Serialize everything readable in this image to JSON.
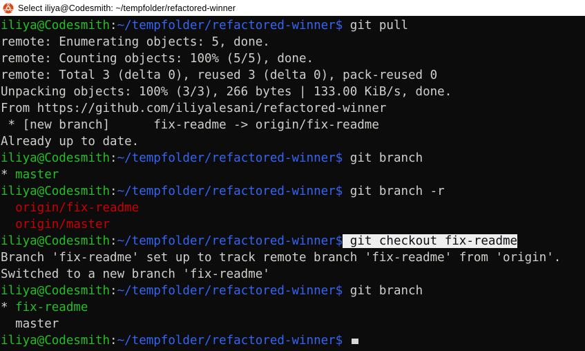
{
  "window": {
    "title": "Select iliya@Codesmith: ~/tempfolder/refactored-winner",
    "icon": "ubuntu-logo-icon",
    "titlebar_bg": "#ffffff",
    "titlebar_fg": "#000000"
  },
  "terminal": {
    "background": "#0c0c0c",
    "foreground": "#cccccc",
    "colors": {
      "green": "#26bd26",
      "blue": "#3465f4",
      "red": "#cc0000",
      "white": "#d0cfcc",
      "selection_bg": "#eeeeee",
      "selection_fg": "#0c0c12"
    },
    "prompt": {
      "user_host": "iliya@Codesmith",
      "separator": ":",
      "path": "~/tempfolder/refactored-winner",
      "sigil": "$"
    },
    "lines": [
      {
        "type": "prompt",
        "command": " git pull"
      },
      {
        "type": "output",
        "text": "remote: Enumerating objects: 5, done."
      },
      {
        "type": "output",
        "text": "remote: Counting objects: 100% (5/5), done."
      },
      {
        "type": "output",
        "text": "remote: Total 3 (delta 0), reused 3 (delta 0), pack-reused 0"
      },
      {
        "type": "output",
        "text": "Unpacking objects: 100% (3/3), 266 bytes | 133.00 KiB/s, done."
      },
      {
        "type": "output",
        "text": "From https://github.com/iliyalesani/refactored-winner"
      },
      {
        "type": "output",
        "text": " * [new branch]      fix-readme -> origin/fix-readme"
      },
      {
        "type": "output",
        "text": "Already up to date."
      },
      {
        "type": "prompt",
        "command": " git branch"
      },
      {
        "type": "branch_current",
        "marker": "* ",
        "name": "master"
      },
      {
        "type": "prompt",
        "command": " git branch -r"
      },
      {
        "type": "branch_remote",
        "marker": "  ",
        "name": "origin/fix-readme"
      },
      {
        "type": "branch_remote",
        "marker": "  ",
        "name": "origin/master"
      },
      {
        "type": "prompt_selected",
        "command": " git checkout fix-readme"
      },
      {
        "type": "output",
        "text": "Branch 'fix-readme' set up to track remote branch 'fix-readme' from 'origin'."
      },
      {
        "type": "output",
        "text": "Switched to a new branch 'fix-readme'"
      },
      {
        "type": "prompt",
        "command": " git branch"
      },
      {
        "type": "branch_current",
        "marker": "* ",
        "name": "fix-readme"
      },
      {
        "type": "branch_plain",
        "marker": "  ",
        "name": "master"
      },
      {
        "type": "prompt_cursor",
        "command": " "
      }
    ]
  }
}
